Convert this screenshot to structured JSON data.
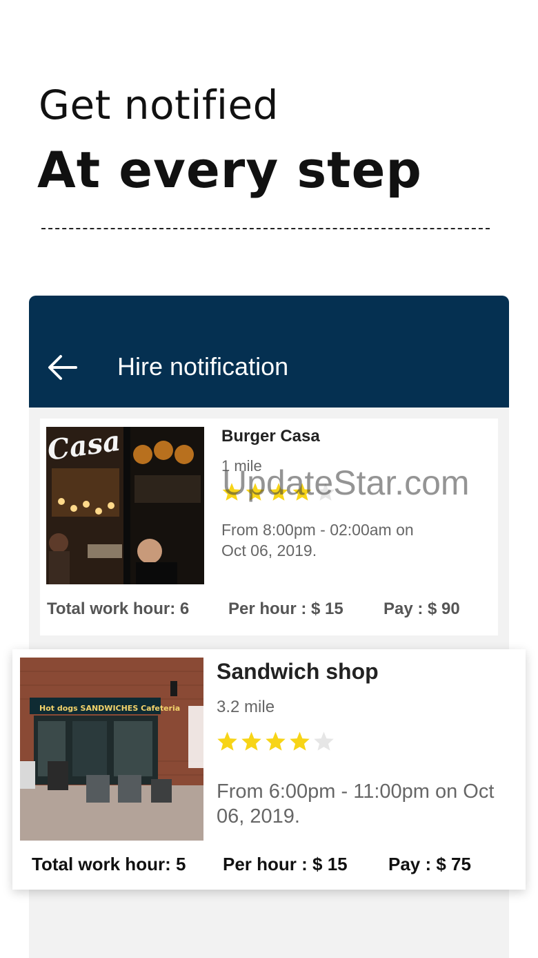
{
  "promo": {
    "line1": "Get notified",
    "line2": "At every step"
  },
  "appbar": {
    "title": "Hire notification",
    "color": "#053051"
  },
  "notifications": [
    {
      "name": "Burger Casa",
      "distance": "1 mile",
      "rating": 4,
      "rating_max": 5,
      "time": "From 8:00pm - 02:00am on Oct 06, 2019.",
      "total_work_hour": "Total work hour: 6",
      "per_hour": "Per hour : $ 15",
      "pay": "Pay : $ 90",
      "image_sign": "Casa"
    },
    {
      "name": "Sandwich shop",
      "distance": "3.2 mile",
      "rating": 4,
      "rating_max": 5,
      "time": "From 6:00pm - 11:00pm on Oct 06, 2019.",
      "total_work_hour": "Total work hour: 5",
      "per_hour": "Per hour : $ 15",
      "pay": "Pay : $ 75",
      "image_sign": "Hot dogs  SANDWICHES  Cafeteria"
    }
  ],
  "watermark": "UpdateStar.com",
  "colors": {
    "star_filled": "#f7d417",
    "star_empty": "#e6e6e6"
  }
}
